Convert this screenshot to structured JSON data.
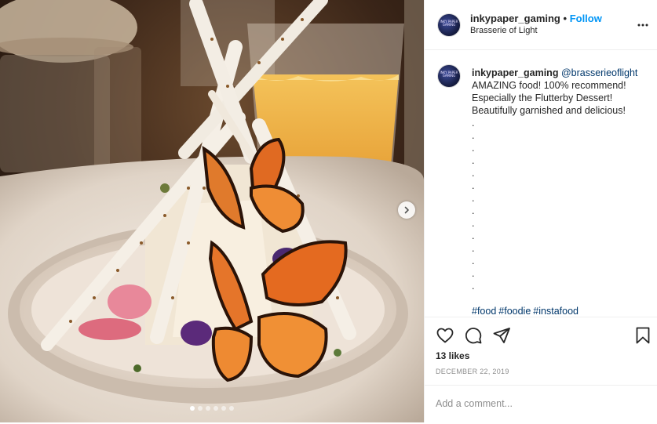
{
  "post": {
    "username": "inkypaper_gaming",
    "separator": "•",
    "follow_label": "Follow",
    "location": "Brasserie of Light",
    "avatar_text": "INKY PAPER GAMING"
  },
  "caption": {
    "username": "inkypaper_gaming",
    "mention": "@brasserieoflight",
    "lines": [
      "AMAZING food! 100% recommend!",
      "Especially the Flutterby Dessert!",
      "Beautifully garnished and delicious!",
      ".",
      ".",
      ".",
      ".",
      ".",
      ".",
      ".",
      ".",
      ".",
      ".",
      ".",
      ".",
      ".",
      "."
    ],
    "hashtags": [
      "#food",
      "#foodie",
      "#instafood"
    ]
  },
  "stats": {
    "likes": "13 likes",
    "date": "DECEMBER 22, 2019"
  },
  "comment": {
    "placeholder": "Add a comment..."
  },
  "carousel": {
    "total": 6,
    "active": 0
  },
  "icons": {
    "more": "more-options-icon",
    "like": "heart-icon",
    "comment": "comment-icon",
    "share": "share-icon",
    "save": "bookmark-icon",
    "next": "chevron-right-icon"
  },
  "colors": {
    "follow": "#0095f6",
    "link": "#00376b",
    "muted": "#8e8e8e",
    "border": "#efefef"
  }
}
